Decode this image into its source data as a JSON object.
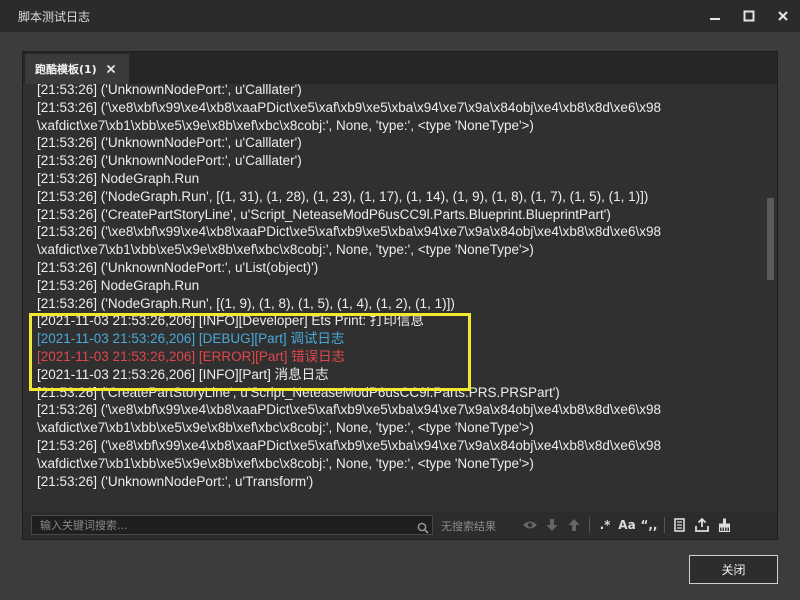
{
  "window": {
    "title": "脚本测试日志",
    "controls": [
      "minimize-icon",
      "maximize-icon",
      "close-icon"
    ]
  },
  "tab": {
    "label": "跑酷模板(1)"
  },
  "log_lines": [
    {
      "text": "[21:53:26] ('UnknownNodePort:', u'Calllater')",
      "level": "normal"
    },
    {
      "text": "[21:53:26] ('\\xe8\\xbf\\x99\\xe4\\xb8\\xaaPDict\\xe5\\xaf\\xb9\\xe5\\xba\\x94\\xe7\\x9a\\x84obj\\xe4\\xb8\\x8d\\xe6\\x98",
      "level": "normal"
    },
    {
      "text": "\\xafdict\\xe7\\xb1\\xbb\\xe5\\x9e\\x8b\\xef\\xbc\\x8cobj:', None, 'type:', <type 'NoneType'>)",
      "level": "normal"
    },
    {
      "text": "[21:53:26] ('UnknownNodePort:', u'Calllater')",
      "level": "normal"
    },
    {
      "text": "[21:53:26] ('UnknownNodePort:', u'Calllater')",
      "level": "normal"
    },
    {
      "text": "[21:53:26] NodeGraph.Run",
      "level": "normal"
    },
    {
      "text": "[21:53:26] ('NodeGraph.Run', [(1, 31), (1, 28), (1, 23), (1, 17), (1, 14), (1, 9), (1, 8), (1, 7), (1, 5), (1, 1)])",
      "level": "normal"
    },
    {
      "text": "[21:53:26] ('CreatePartStoryLine', u'Script_NeteaseModP6usCC9l.Parts.Blueprint.BlueprintPart')",
      "level": "normal"
    },
    {
      "text": "[21:53:26] ('\\xe8\\xbf\\x99\\xe4\\xb8\\xaaPDict\\xe5\\xaf\\xb9\\xe5\\xba\\x94\\xe7\\x9a\\x84obj\\xe4\\xb8\\x8d\\xe6\\x98",
      "level": "normal"
    },
    {
      "text": "\\xafdict\\xe7\\xb1\\xbb\\xe5\\x9e\\x8b\\xef\\xbc\\x8cobj:', None, 'type:', <type 'NoneType'>)",
      "level": "normal"
    },
    {
      "text": "[21:53:26] ('UnknownNodePort:', u'List(object)')",
      "level": "normal"
    },
    {
      "text": "[21:53:26] NodeGraph.Run",
      "level": "normal"
    },
    {
      "text": "[21:53:26] ('NodeGraph.Run', [(1, 9), (1, 8), (1, 5), (1, 4), (1, 2), (1, 1)])",
      "level": "normal"
    },
    {
      "text": "[2021-11-03 21:53:26,206] [INFO][Developer] Ets Print: 打印信息",
      "level": "normal"
    },
    {
      "text": "[2021-11-03 21:53:26,206] [DEBUG][Part] 调试日志",
      "level": "debug"
    },
    {
      "text": "[2021-11-03 21:53:26,206] [ERROR][Part] 错误日志",
      "level": "error"
    },
    {
      "text": "[2021-11-03 21:53:26,206] [INFO][Part] 消息日志",
      "level": "normal"
    },
    {
      "text": "[21:53:26] ('CreatePartStoryLine', u'Script_NeteaseModP6usCC9l.Parts.PRS.PRSPart')",
      "level": "normal"
    },
    {
      "text": "[21:53:26] ('\\xe8\\xbf\\x99\\xe4\\xb8\\xaaPDict\\xe5\\xaf\\xb9\\xe5\\xba\\x94\\xe7\\x9a\\x84obj\\xe4\\xb8\\x8d\\xe6\\x98",
      "level": "normal"
    },
    {
      "text": "\\xafdict\\xe7\\xb1\\xbb\\xe5\\x9e\\x8b\\xef\\xbc\\x8cobj:', None, 'type:', <type 'NoneType'>)",
      "level": "normal"
    },
    {
      "text": "[21:53:26] ('\\xe8\\xbf\\x99\\xe4\\xb8\\xaaPDict\\xe5\\xaf\\xb9\\xe5\\xba\\x94\\xe7\\x9a\\x84obj\\xe4\\xb8\\x8d\\xe6\\x98",
      "level": "normal"
    },
    {
      "text": "\\xafdict\\xe7\\xb1\\xbb\\xe5\\x9e\\x8b\\xef\\xbc\\x8cobj:', None, 'type:', <type 'NoneType'>)",
      "level": "normal"
    },
    {
      "text": "[21:53:26] ('UnknownNodePort:', u'Transform')",
      "level": "normal"
    }
  ],
  "colors": {
    "debug": "#4aa9d8",
    "error": "#e0474c",
    "highlight": "#f2e82e"
  },
  "search": {
    "placeholder": "输入关键词搜索...",
    "no_result": "无搜索结果"
  },
  "toolbar": {
    "regex_label": ".*",
    "match_case_label": "Aa",
    "whole_word_label": "“,,",
    "icons": [
      "eye-icon",
      "arrow-down-icon",
      "arrow-up-icon",
      "copy-icon",
      "export-icon",
      "clear-icon"
    ]
  },
  "footer": {
    "close_label": "关闭"
  }
}
